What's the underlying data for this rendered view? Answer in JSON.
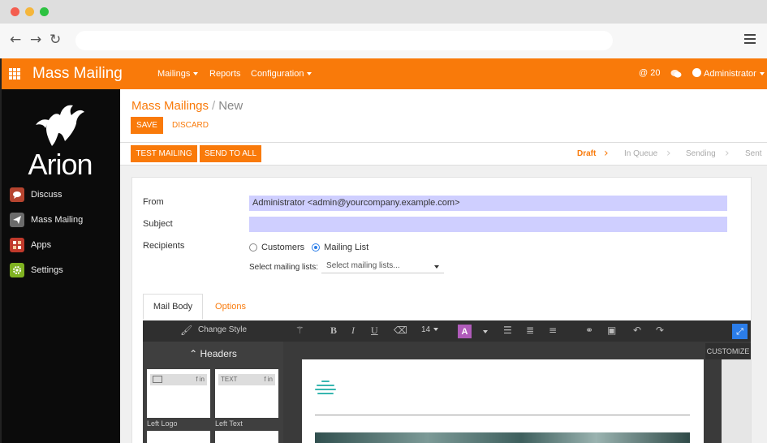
{
  "topbar": {
    "app_title": "Mass Mailing",
    "menu": [
      "Mailings",
      "Reports",
      "Configuration"
    ],
    "notifications": "@ 20",
    "user": "Administrator"
  },
  "sidebar": {
    "logo_text": "Arion",
    "items": [
      {
        "label": "Discuss",
        "icon": "chat-icon",
        "color": "#b5442f"
      },
      {
        "label": "Mass Mailing",
        "icon": "paper-plane-icon",
        "color": "#6b6b6b"
      },
      {
        "label": "Apps",
        "icon": "apps-icon",
        "color": "#c0392b"
      },
      {
        "label": "Settings",
        "icon": "gear-icon",
        "color": "#7fb221"
      }
    ]
  },
  "breadcrumb": {
    "parent": "Mass Mailings",
    "separator": "/",
    "current": "New"
  },
  "buttons": {
    "save": "SAVE",
    "discard": "DISCARD",
    "test_mailing": "TEST MAILING",
    "send_to_all": "SEND TO ALL"
  },
  "stages": [
    "Draft",
    "In Queue",
    "Sending",
    "Sent"
  ],
  "form": {
    "from_label": "From",
    "from_value": "Administrator <admin@yourcompany.example.com>",
    "subject_label": "Subject",
    "subject_value": "",
    "recipients_label": "Recipients",
    "recipient_options": [
      "Customers",
      "Mailing List"
    ],
    "selected_recipient": "Mailing List",
    "mailing_lists_label": "Select mailing lists:",
    "mailing_lists_placeholder": "Select mailing lists..."
  },
  "tabs": [
    "Mail Body",
    "Options"
  ],
  "editor": {
    "change_style": "Change Style",
    "font_size": "14",
    "color_letter": "A",
    "snippets_header": "Headers",
    "snippets": [
      {
        "label": "Left Logo",
        "bar_text": ""
      },
      {
        "label": "Left Text",
        "bar_text": "TEXT"
      }
    ],
    "social_text": "f in",
    "customize": "CUSTOMIZE"
  },
  "colors": {
    "brand": "#f97a0a",
    "sidebar_bg": "#0b0b0b",
    "input_highlight": "#cfcfff",
    "link_blue": "#2b7de9"
  }
}
